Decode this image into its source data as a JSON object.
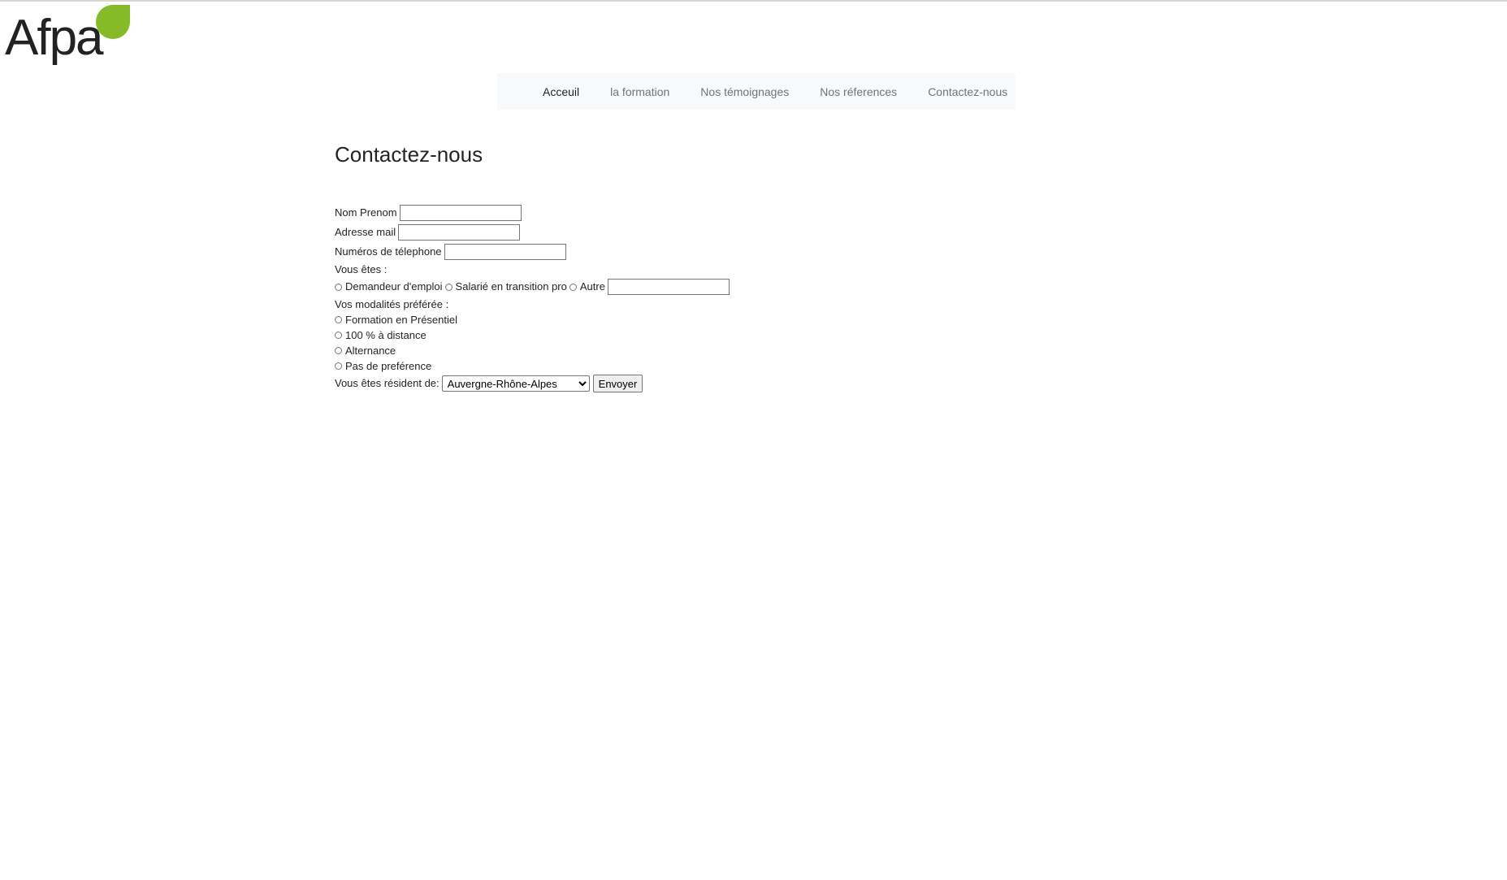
{
  "logo": {
    "text": "Afpa",
    "leaf_color": "#84bb26"
  },
  "nav": {
    "items": [
      {
        "label": "Acceuil",
        "active": true
      },
      {
        "label": "la formation",
        "active": false
      },
      {
        "label": "Nos témoignages",
        "active": false
      },
      {
        "label": "Nos réferences",
        "active": false
      },
      {
        "label": "Contactez-nous",
        "active": false
      }
    ]
  },
  "page": {
    "title": "Contactez-nous"
  },
  "form": {
    "name_label": "Nom Prenom",
    "name_value": "",
    "email_label": "Adresse mail",
    "email_value": "",
    "phone_label": "Numéros de télephone",
    "phone_value": "",
    "status_label": "Vous êtes :",
    "status_options": [
      "Demandeur d'emploi",
      "Salarié en transition pro",
      "Autre"
    ],
    "other_value": "",
    "modality_label": "Vos modalités préférée :",
    "modality_options": [
      "Formation en Présentiel",
      "100 % à distance",
      "Alternance",
      "Pas de preférence"
    ],
    "region_label": "Vous êtes résident de:",
    "region_selected": "Auvergne-Rhône-Alpes",
    "submit_label": "Envoyer"
  }
}
